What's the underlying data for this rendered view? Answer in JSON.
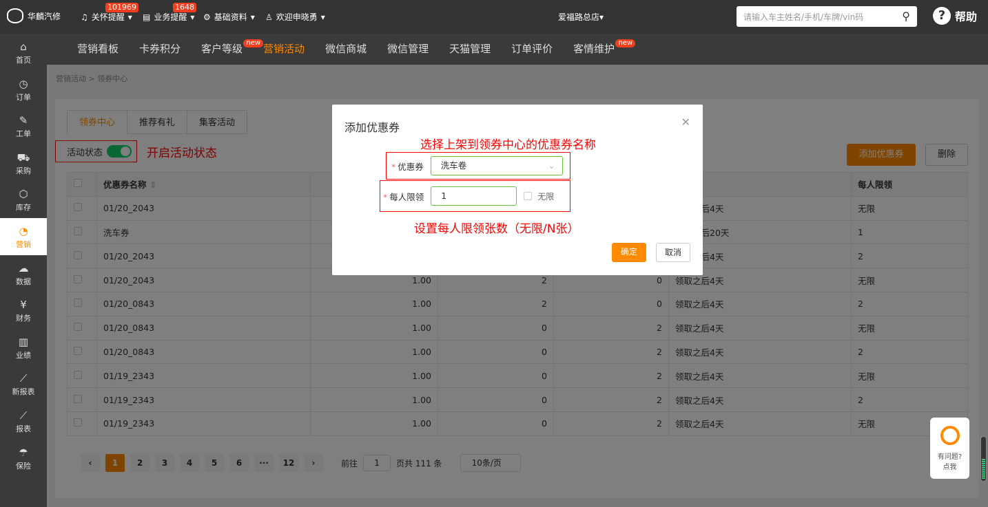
{
  "topbar": {
    "brand": "华麟汽修",
    "menus": [
      {
        "label": "关怀提醒",
        "badge": "101969",
        "icon": "bell-icon"
      },
      {
        "label": "业务提醒",
        "badge": "1648",
        "icon": "document-icon"
      },
      {
        "label": "基础资料",
        "icon": "gear-icon"
      },
      {
        "label": "欢迎申晓勇",
        "icon": "user-icon"
      }
    ],
    "store": "爱福路总店",
    "search_placeholder": "请输入车主姓名/手机/车牌/vin码",
    "help": "帮助"
  },
  "nav": [
    {
      "label": "营销看板"
    },
    {
      "label": "卡券积分"
    },
    {
      "label": "客户等级",
      "new": "new"
    },
    {
      "label": "营销活动",
      "active": true
    },
    {
      "label": "微信商城"
    },
    {
      "label": "微信管理"
    },
    {
      "label": "天猫管理"
    },
    {
      "label": "订单评价"
    },
    {
      "label": "客情维护",
      "new": "new"
    }
  ],
  "sidebar": [
    {
      "label": "首页",
      "icon": "⌂"
    },
    {
      "label": "订单",
      "icon": "◷"
    },
    {
      "label": "工单",
      "icon": "✎"
    },
    {
      "label": "采购",
      "icon": "⛟"
    },
    {
      "label": "库存",
      "icon": "⬡"
    },
    {
      "label": "营销",
      "icon": "◔",
      "active": true
    },
    {
      "label": "数据",
      "icon": "☁"
    },
    {
      "label": "财务",
      "icon": "¥"
    },
    {
      "label": "业绩",
      "icon": "▥"
    },
    {
      "label": "新报表",
      "icon": "⟋"
    },
    {
      "label": "报表",
      "icon": "⟋"
    },
    {
      "label": "保险",
      "icon": "☂"
    }
  ],
  "breadcrumb": [
    "营销活动",
    "领券中心"
  ],
  "tabs": [
    "领券中心",
    "推荐有礼",
    "集客活动"
  ],
  "status": {
    "label": "活动状态",
    "on": true,
    "annotation": "开启活动状态"
  },
  "buttons": {
    "add": "添加优惠券",
    "delete": "删除"
  },
  "table": {
    "headers": [
      "优惠券名称",
      "",
      "",
      "",
      "",
      "每人限领"
    ],
    "rows": [
      [
        "01/20_2043",
        "",
        "",
        "",
        "领取之后4天",
        "无限"
      ],
      [
        "洗车券",
        "",
        "",
        "",
        "领取之后20天",
        "1"
      ],
      [
        "01/20_2043",
        "",
        "",
        "",
        "领取之后4天",
        "2"
      ],
      [
        "01/20_2043",
        "1.00",
        "2",
        "0",
        "领取之后4天",
        "无限"
      ],
      [
        "01/20_0843",
        "1.00",
        "2",
        "0",
        "领取之后4天",
        "2"
      ],
      [
        "01/20_0843",
        "1.00",
        "0",
        "2",
        "领取之后4天",
        "无限"
      ],
      [
        "01/20_0843",
        "1.00",
        "0",
        "2",
        "领取之后4天",
        "2"
      ],
      [
        "01/19_2343",
        "1.00",
        "0",
        "2",
        "领取之后4天",
        "无限"
      ],
      [
        "01/19_2343",
        "1.00",
        "0",
        "2",
        "领取之后4天",
        "2"
      ],
      [
        "01/19_2343",
        "1.00",
        "0",
        "2",
        "领取之后4天",
        "无限"
      ]
    ]
  },
  "pager": {
    "pages": [
      "1",
      "2",
      "3",
      "4",
      "5",
      "6",
      "···",
      "12"
    ],
    "current": "1",
    "goto_label": "前往",
    "goto_value": "1",
    "total": "页共 111 条",
    "size": "10条/页"
  },
  "modal": {
    "title": "添加优惠券",
    "coupon_label": "优惠券",
    "coupon_value": "洗车卷",
    "limit_label": "每人限领",
    "limit_value": "1",
    "unlimited": "无限",
    "ok": "确定",
    "cancel": "取消",
    "annotation1": "选择上架到领券中心的优惠券名称",
    "annotation2": "设置每人限领张数（无限/N张）"
  },
  "float_help": {
    "line1": "有问题?",
    "line2": "点我"
  }
}
